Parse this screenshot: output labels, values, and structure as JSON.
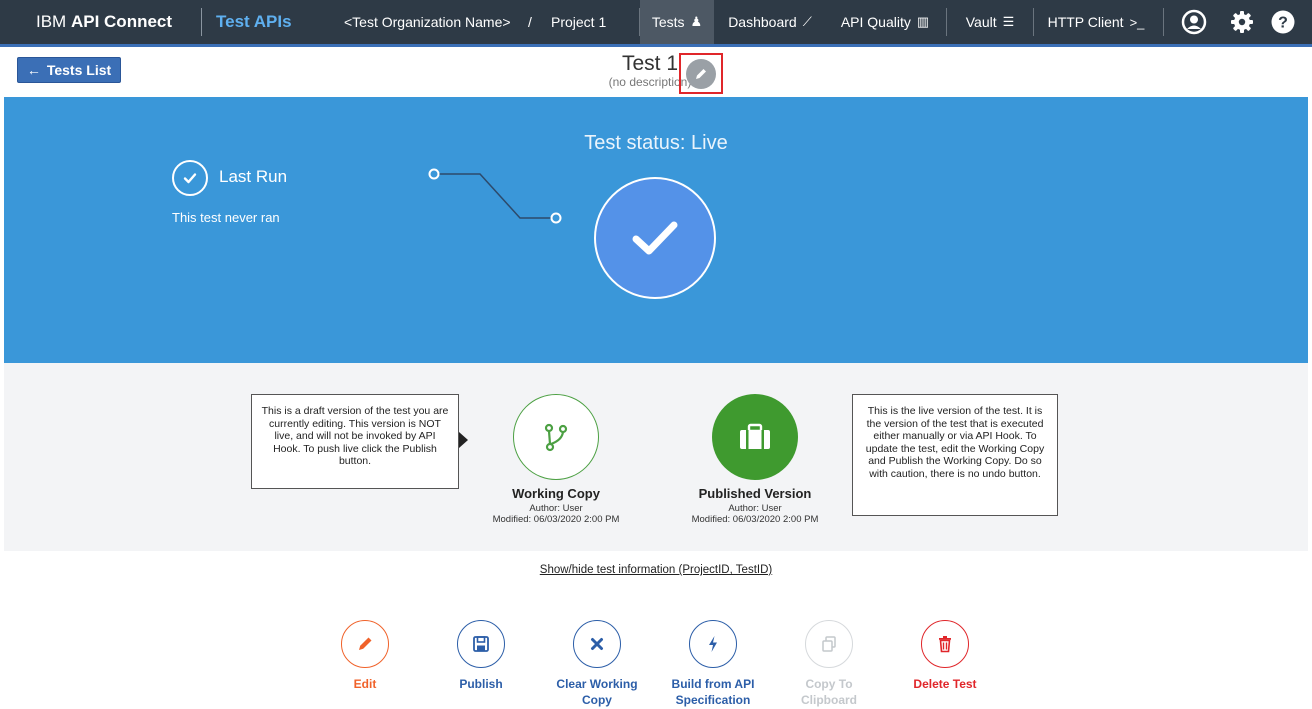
{
  "nav": {
    "brand_prefix": "IBM",
    "brand_name": "API Connect",
    "app_name": "Test APIs",
    "organization": "<Test Organization Name>",
    "crumb_separator": "/",
    "project": "Project 1",
    "items": [
      {
        "label": "Tests",
        "icon": "flask-icon",
        "glyph": "♟",
        "active": true
      },
      {
        "label": "Dashboard",
        "icon": "line-chart-icon",
        "glyph": "⟋",
        "active": false
      },
      {
        "label": "API Quality",
        "icon": "bar-chart-icon",
        "glyph": "▥",
        "active": false
      },
      {
        "label": "Vault",
        "icon": "database-icon",
        "glyph": "☰",
        "active": false
      },
      {
        "label": "HTTP Client",
        "icon": "terminal-icon",
        "glyph": ">_",
        "active": false
      }
    ],
    "right_icons": [
      "user-icon",
      "gear-icon",
      "help-icon"
    ]
  },
  "header": {
    "back_label": "Tests List",
    "back_arrow": "←",
    "title": "Test 1",
    "description": "(no description)"
  },
  "status": {
    "heading": "Test status: Live",
    "last_run_label": "Last Run",
    "last_run_text": "This test never ran"
  },
  "versions": {
    "draft_note": "This is a draft version of the test you are currently editing. This version is NOT live, and will not be invoked by API Hook. To push live click the Publish button.",
    "live_note": "This is the live version of the test. It is the version of the test that is executed either manually or via API Hook. To update the test, edit the Working Copy and Publish the Working Copy. Do so with caution, there is no undo button.",
    "working_copy": {
      "name": "Working Copy",
      "author": "Author: User",
      "modified": "Modified: 06/03/2020 2:00 PM"
    },
    "published": {
      "name": "Published Version",
      "author": "Author: User",
      "modified": "Modified: 06/03/2020 2:00 PM"
    }
  },
  "info_link": "Show/hide test information (ProjectID, TestID)",
  "actions": [
    {
      "label_1": "Edit",
      "label_2": "",
      "icon": "pencil-icon",
      "color": "#f0622a",
      "enabled": true
    },
    {
      "label_1": "Publish",
      "label_2": "",
      "icon": "save-icon",
      "color": "#2c5ea8",
      "enabled": true
    },
    {
      "label_1": "Clear Working",
      "label_2": "Copy",
      "icon": "close-icon",
      "color": "#2c5ea8",
      "enabled": true
    },
    {
      "label_1": "Build from API",
      "label_2": "Specification",
      "icon": "lightning-icon",
      "color": "#2c5ea8",
      "enabled": true
    },
    {
      "label_1": "Copy To",
      "label_2": "Clipboard",
      "icon": "copy-icon",
      "color": "#c4c8cc",
      "enabled": false
    },
    {
      "label_1": "Delete Test",
      "label_2": "",
      "icon": "trash-icon",
      "color": "#e0262a",
      "enabled": true
    }
  ],
  "colors": {
    "nav_bg": "#2e3a46",
    "brand_accent": "#5fb0f0",
    "status_band": "#3a97d9",
    "live_check": "#5492e8",
    "published_green": "#3f9a2f",
    "highlight_red": "#e0262a"
  }
}
